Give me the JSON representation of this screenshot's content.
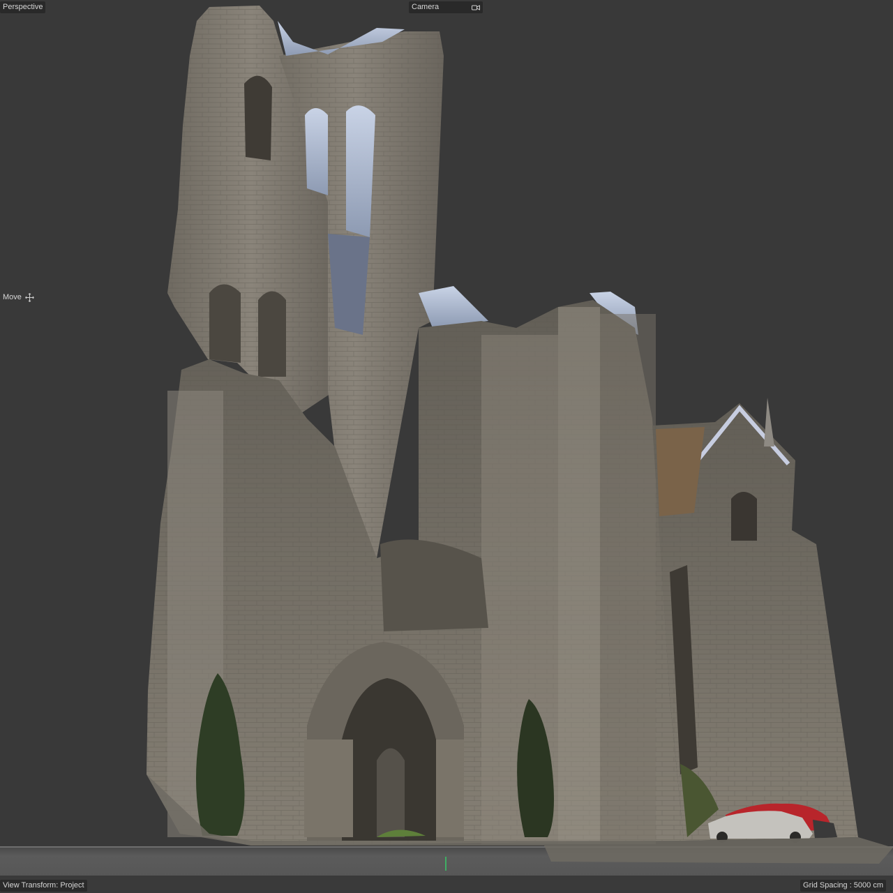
{
  "viewport": {
    "projection_label": "Perspective",
    "camera_label": "Camera",
    "camera_icon": "camera-icon",
    "tool_label": "Move",
    "tool_icon": "move-crosshair-icon",
    "view_transform": "View Transform: Project",
    "grid_spacing": "Grid Spacing : 5000 cm"
  },
  "model": {
    "subject": "photogrammetry-ruined-gothic-abbey",
    "colors": {
      "background": "#393939",
      "stone": "#7d776c",
      "stone_dark": "#4e4a43",
      "sky": "#b8c4d8",
      "foliage": "#2f3d26",
      "car_red": "#c0262c",
      "car_silver": "#c4c2bd"
    }
  }
}
